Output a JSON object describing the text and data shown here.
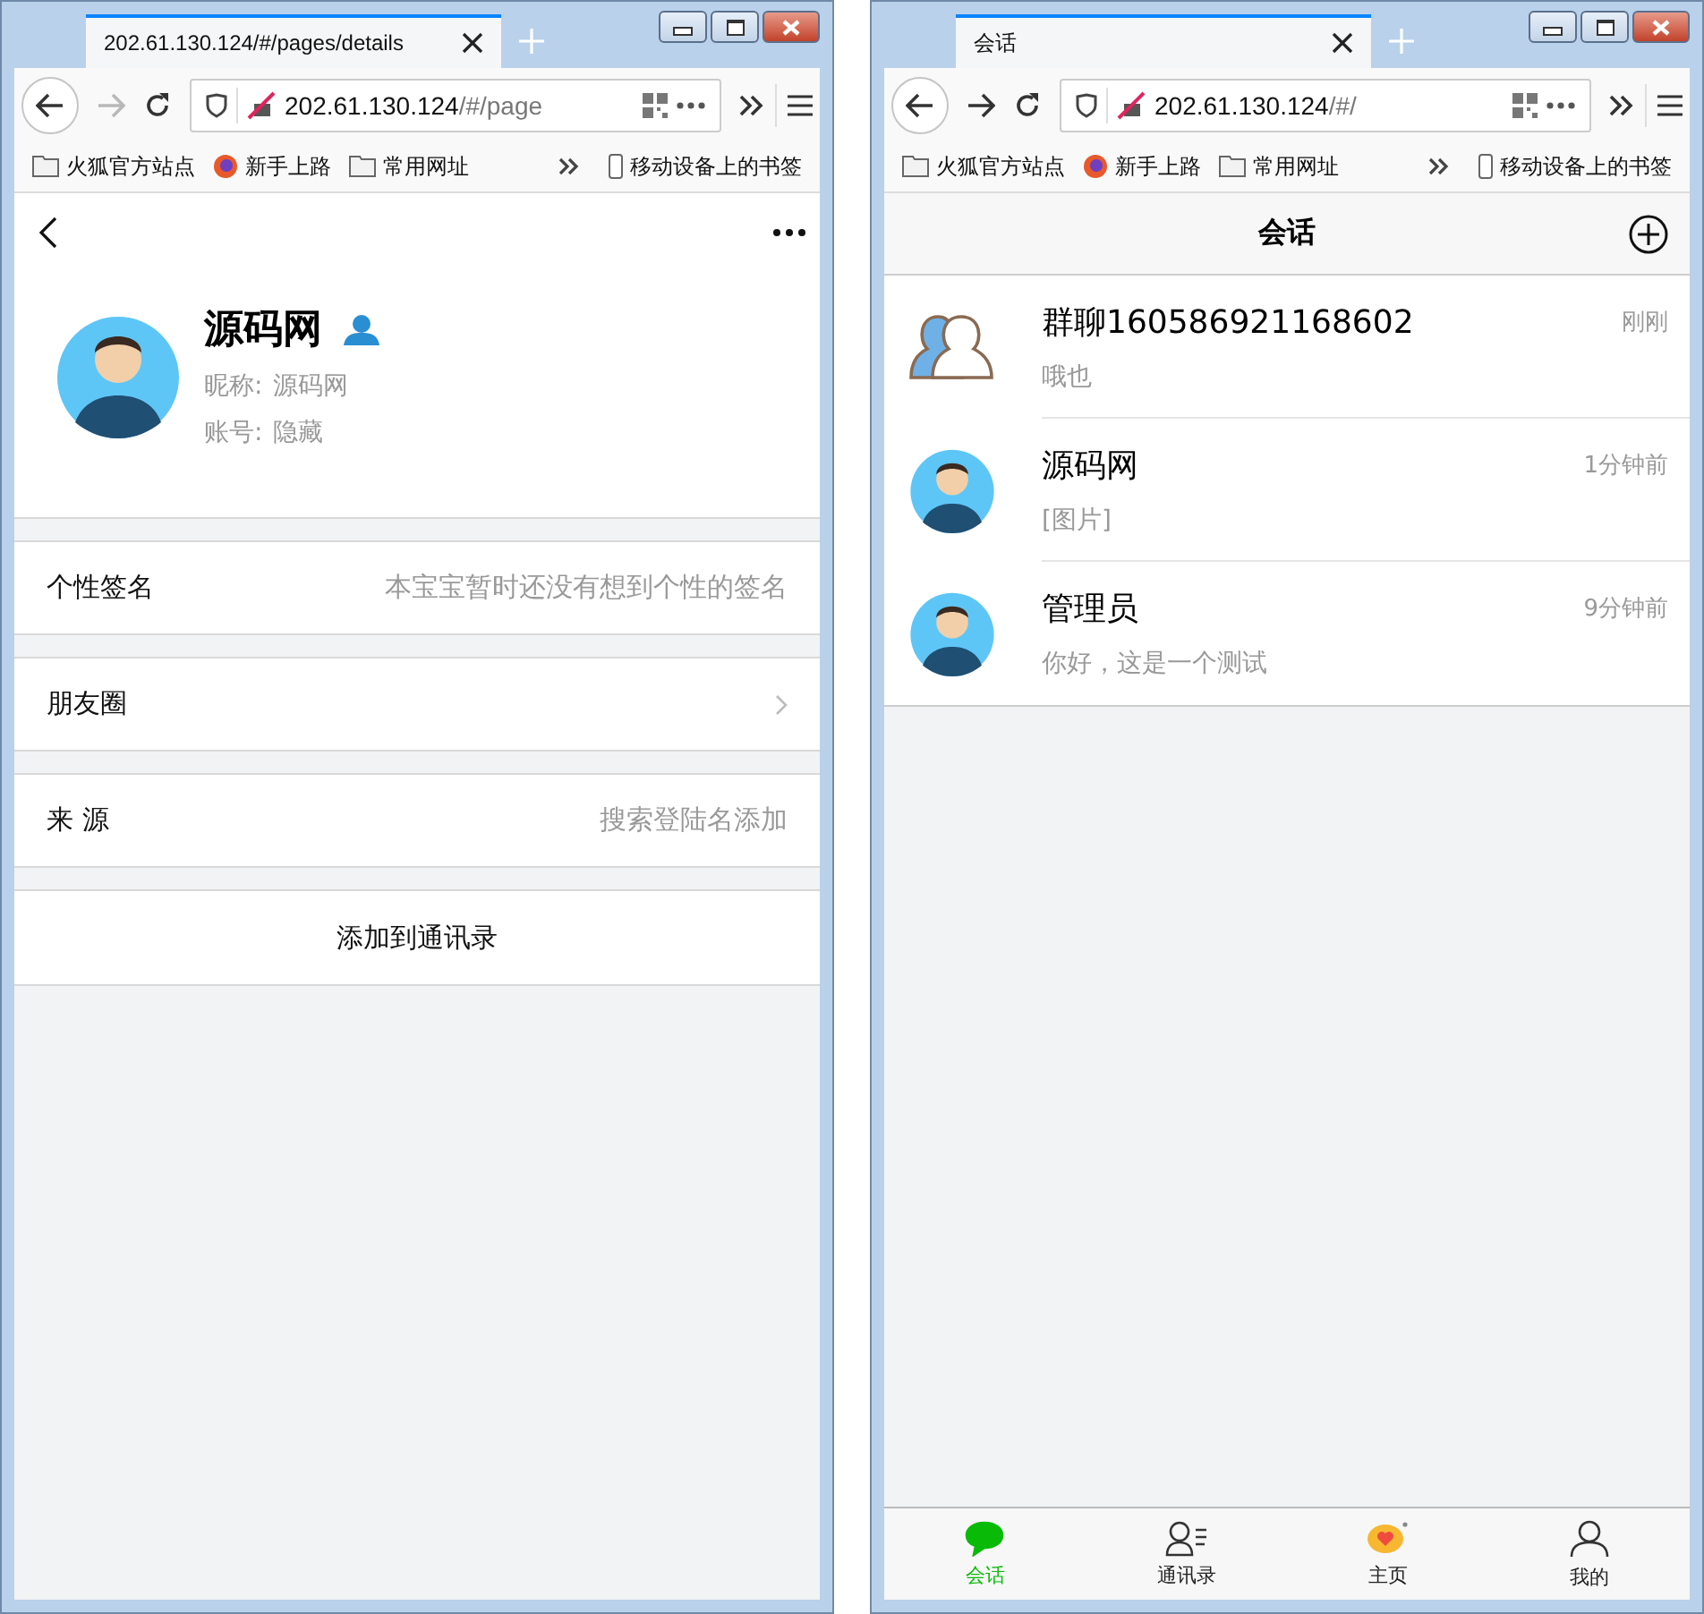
{
  "windows": [
    {
      "tab_title": "202.61.130.124/#/pages/details",
      "url_host": "202.61.130.124",
      "url_path": "/#/page",
      "forward_disabled": true,
      "bookmarks": [
        {
          "kind": "folder",
          "label": "火狐官方站点"
        },
        {
          "kind": "firefox",
          "label": "新手上路"
        },
        {
          "kind": "folder",
          "label": "常用网址"
        }
      ],
      "mobile_bookmarks": "移动设备上的书签",
      "page": {
        "kind": "profile",
        "name": "源码网",
        "nickname_label": "昵称:",
        "nickname": "源码网",
        "account_label": "账号:",
        "account": "隐藏",
        "rows": [
          {
            "kind": "value",
            "label": "个性签名",
            "value": "本宝宝暂时还没有想到个性的签名"
          },
          {
            "kind": "link",
            "label": "朋友圈"
          },
          {
            "kind": "value",
            "label": "来 源",
            "value": "搜索登陆名添加"
          }
        ],
        "action": "添加到通讯录"
      }
    },
    {
      "tab_title": "会话",
      "url_host": "202.61.130.124",
      "url_path": "/#/",
      "forward_disabled": false,
      "bookmarks": [
        {
          "kind": "folder",
          "label": "火狐官方站点"
        },
        {
          "kind": "firefox",
          "label": "新手上路"
        },
        {
          "kind": "folder",
          "label": "常用网址"
        }
      ],
      "mobile_bookmarks": "移动设备上的书签",
      "page": {
        "kind": "chats",
        "title": "会话",
        "chats": [
          {
            "kind": "group",
            "name": "群聊160586921168602",
            "time": "刚刚",
            "preview": "哦也"
          },
          {
            "kind": "user",
            "name": "源码网",
            "time": "1分钟前",
            "preview": "[图片]"
          },
          {
            "kind": "user",
            "name": "管理员",
            "time": "9分钟前",
            "preview": "你好，这是一个测试"
          }
        ],
        "tabbar": [
          {
            "kind": "chat",
            "label": "会话",
            "selected": true
          },
          {
            "kind": "contacts",
            "label": "通讯录",
            "selected": false
          },
          {
            "kind": "home",
            "label": "主页",
            "selected": false
          },
          {
            "kind": "me",
            "label": "我的",
            "selected": false
          }
        ]
      }
    }
  ]
}
